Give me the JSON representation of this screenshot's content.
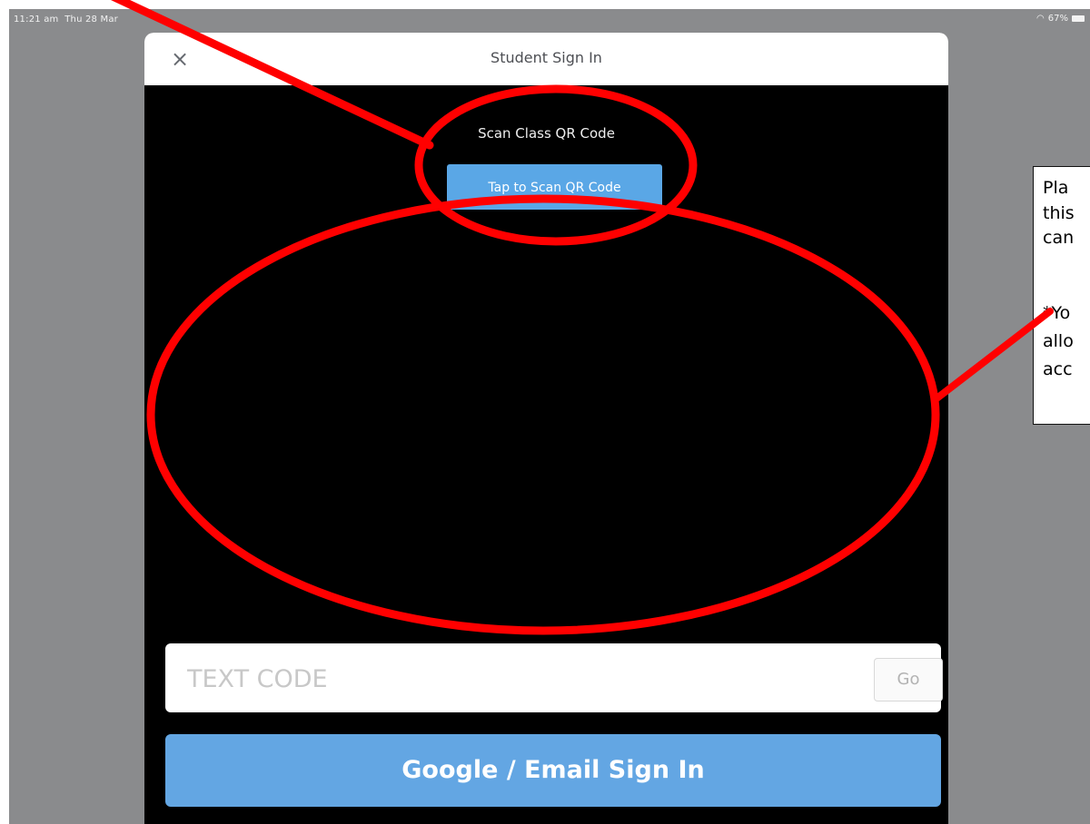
{
  "status_bar": {
    "time": "11:21 am",
    "date": "Thu 28 Mar",
    "battery": "67%"
  },
  "modal": {
    "close_icon": "×",
    "title": "Student Sign In",
    "scan_label": "Scan Class QR Code",
    "scan_button": "Tap to Scan QR Code",
    "text_code_placeholder": "TEXT CODE",
    "go_button": "Go",
    "google_button": "Google / Email Sign In"
  },
  "annotation": {
    "line1": "Pla",
    "line2": "this",
    "line3": "can",
    "line4": "*Yo",
    "line5": "allo",
    "line6": "acc"
  },
  "colors": {
    "accent": "#5aa7e6",
    "annotation_red": "#ff0000",
    "backdrop": "#8a8b8d"
  }
}
